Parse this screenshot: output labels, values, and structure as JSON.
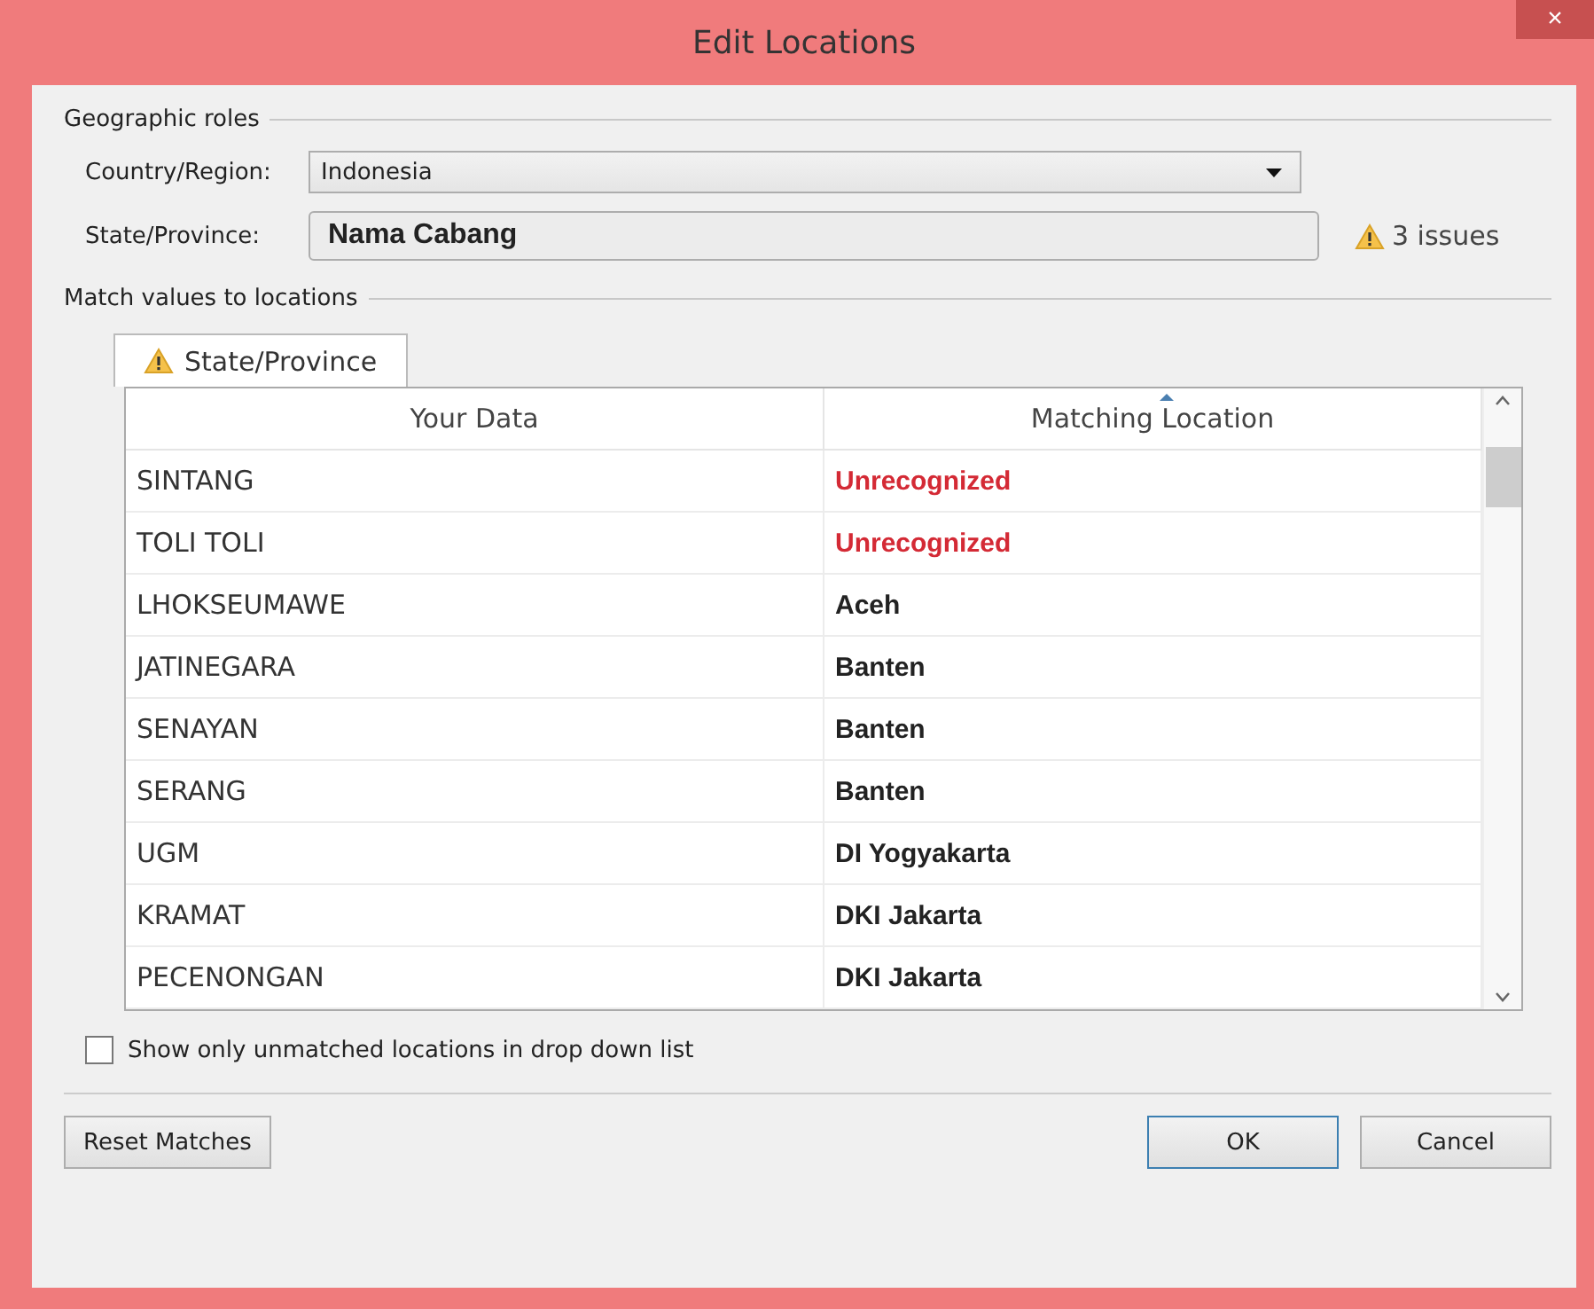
{
  "window": {
    "title": "Edit Locations",
    "close": "×"
  },
  "geographic_roles": {
    "heading": "Geographic roles",
    "country_label": "Country/Region:",
    "country_value": "Indonesia",
    "state_label": "State/Province:",
    "state_value": "Nama Cabang",
    "issues": "3 issues"
  },
  "match": {
    "heading": "Match values to locations",
    "tabs": [
      {
        "label": "State/Province",
        "selected": true,
        "warning": true
      }
    ],
    "columns": [
      {
        "label": "Your Data",
        "sorted": false
      },
      {
        "label": "Matching Location",
        "sorted": true
      }
    ],
    "rows": [
      {
        "data": "SINTANG",
        "location": "Unrecognized",
        "recognized": false
      },
      {
        "data": "TOLI TOLI",
        "location": "Unrecognized",
        "recognized": false
      },
      {
        "data": "LHOKSEUMAWE",
        "location": "Aceh",
        "recognized": true
      },
      {
        "data": "JATINEGARA",
        "location": "Banten",
        "recognized": true
      },
      {
        "data": "SENAYAN",
        "location": "Banten",
        "recognized": true
      },
      {
        "data": "SERANG",
        "location": "Banten",
        "recognized": true
      },
      {
        "data": "UGM",
        "location": "DI Yogyakarta",
        "recognized": true
      },
      {
        "data": "KRAMAT",
        "location": "DKI Jakarta",
        "recognized": true
      },
      {
        "data": "PECENONGAN",
        "location": "DKI Jakarta",
        "recognized": true
      }
    ],
    "unmatched_only": {
      "label": "Show only unmatched locations in drop down list",
      "checked": false
    }
  },
  "buttons": {
    "reset": "Reset Matches",
    "ok": "OK",
    "cancel": "Cancel"
  }
}
